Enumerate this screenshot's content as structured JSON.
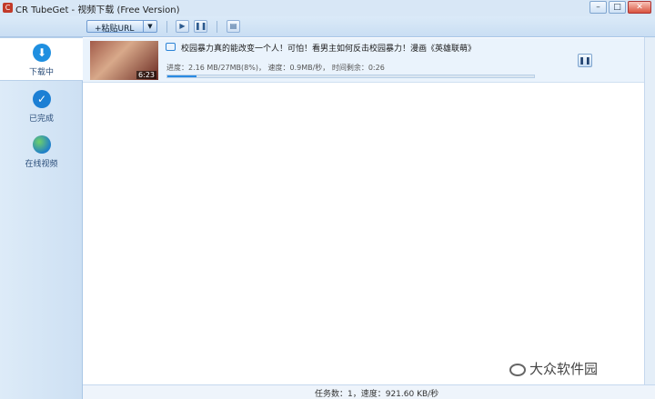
{
  "window": {
    "title": "CR TubeGet - 视频下载 (Free Version)",
    "buttons": [
      "–",
      "□",
      "✕"
    ]
  },
  "toolbar": {
    "url_button": "+粘贴URL",
    "icons": [
      "proxy-icon",
      "pause-all-icon",
      "settings-icon"
    ]
  },
  "sidebar": {
    "items": [
      {
        "label": "下载中",
        "icon": "download-icon",
        "active": true
      },
      {
        "label": "已完成",
        "icon": "check-icon",
        "active": false
      },
      {
        "label": "在线视频",
        "icon": "globe-icon",
        "active": false
      }
    ]
  },
  "download": {
    "title": "校园暴力真的能改变一个人！可怕！看男主如何反击校园暴力！漫画《英雄联萌》",
    "duration": "6:23",
    "progress_text": "进度：2.16 MB/27MB(8%)，  速度：0.9MB/秒，  时间剩余：0:26",
    "progress_percent": 8
  },
  "status": {
    "text": "任务数：1，速度：921.60 KB/秒"
  },
  "watermark": {
    "text": "大众软件园"
  },
  "colors": {
    "accent": "#2a8be2",
    "sidebar_bg": "#d4e5f5",
    "download_icon": "#1f8fe0",
    "check_icon": "#1c7fd4"
  }
}
